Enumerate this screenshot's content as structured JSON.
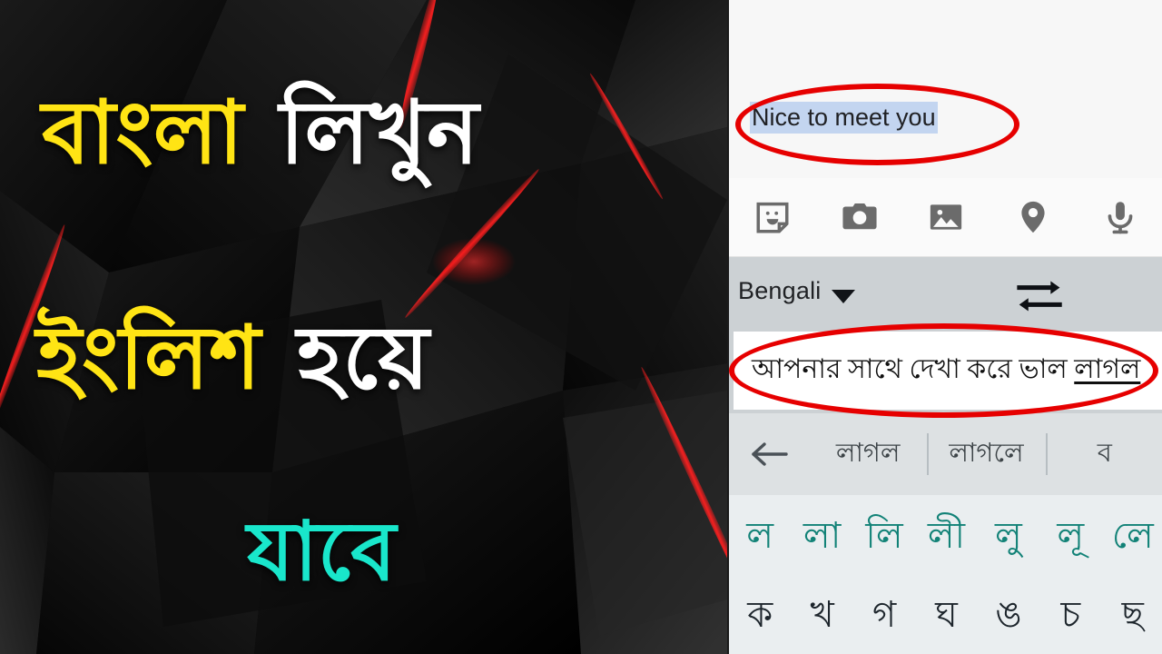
{
  "thumbnail": {
    "line1": {
      "yellow": "বাংলা",
      "white": "লিখুন"
    },
    "line2": {
      "yellow": "ইংলিশ",
      "white": "হয়ে"
    },
    "line3": {
      "cyan": "যাবে"
    },
    "colors": {
      "yellow": "#FFE414",
      "white": "#FFFFFF",
      "cyan": "#19E6CB",
      "background": "#050505",
      "accent_streak": "#d10f12"
    }
  },
  "phone": {
    "compose": {
      "text": "Nice to meet you",
      "selection_color": "#c3d5f0",
      "text_color": "#202124"
    },
    "attachment_icons": [
      {
        "name": "sticker-icon",
        "label": "Sticker"
      },
      {
        "name": "camera-icon",
        "label": "Camera"
      },
      {
        "name": "gallery-icon",
        "label": "Gallery"
      },
      {
        "name": "location-icon",
        "label": "Location"
      },
      {
        "name": "microphone-icon",
        "label": "Microphone"
      }
    ],
    "language_bar": {
      "language": "Bengali",
      "caret_icon": "chevron-down-icon",
      "swap_icon": "swap-arrows-icon",
      "background": "#ccd1d4"
    },
    "output_field": {
      "text_plain": "আপনার সাথে দেখা করে ভাল ",
      "text_composing": "লাগল",
      "full_text": "আপনার সাথে দেখা করে ভাল লাগল"
    },
    "suggestions": {
      "back_icon": "arrow-left-icon",
      "items": [
        "লাগল",
        "লাগলে",
        "ব"
      ]
    },
    "keyboard": {
      "row1": [
        "ল",
        "লা",
        "লি",
        "লী",
        "লু",
        "লূ",
        "লে"
      ],
      "row1_color": "#128277",
      "row2": [
        "ক",
        "খ",
        "গ",
        "ঘ",
        "ঙ",
        "চ",
        "ছ"
      ],
      "row2_color": "#1d252c",
      "background": "#eaeef0"
    }
  },
  "annotations": {
    "color": "#e60000",
    "circle_top_target": "Nice to meet you",
    "circle_bottom_target": "আপনার সাথে দেখা করে ভাল লাগল"
  }
}
